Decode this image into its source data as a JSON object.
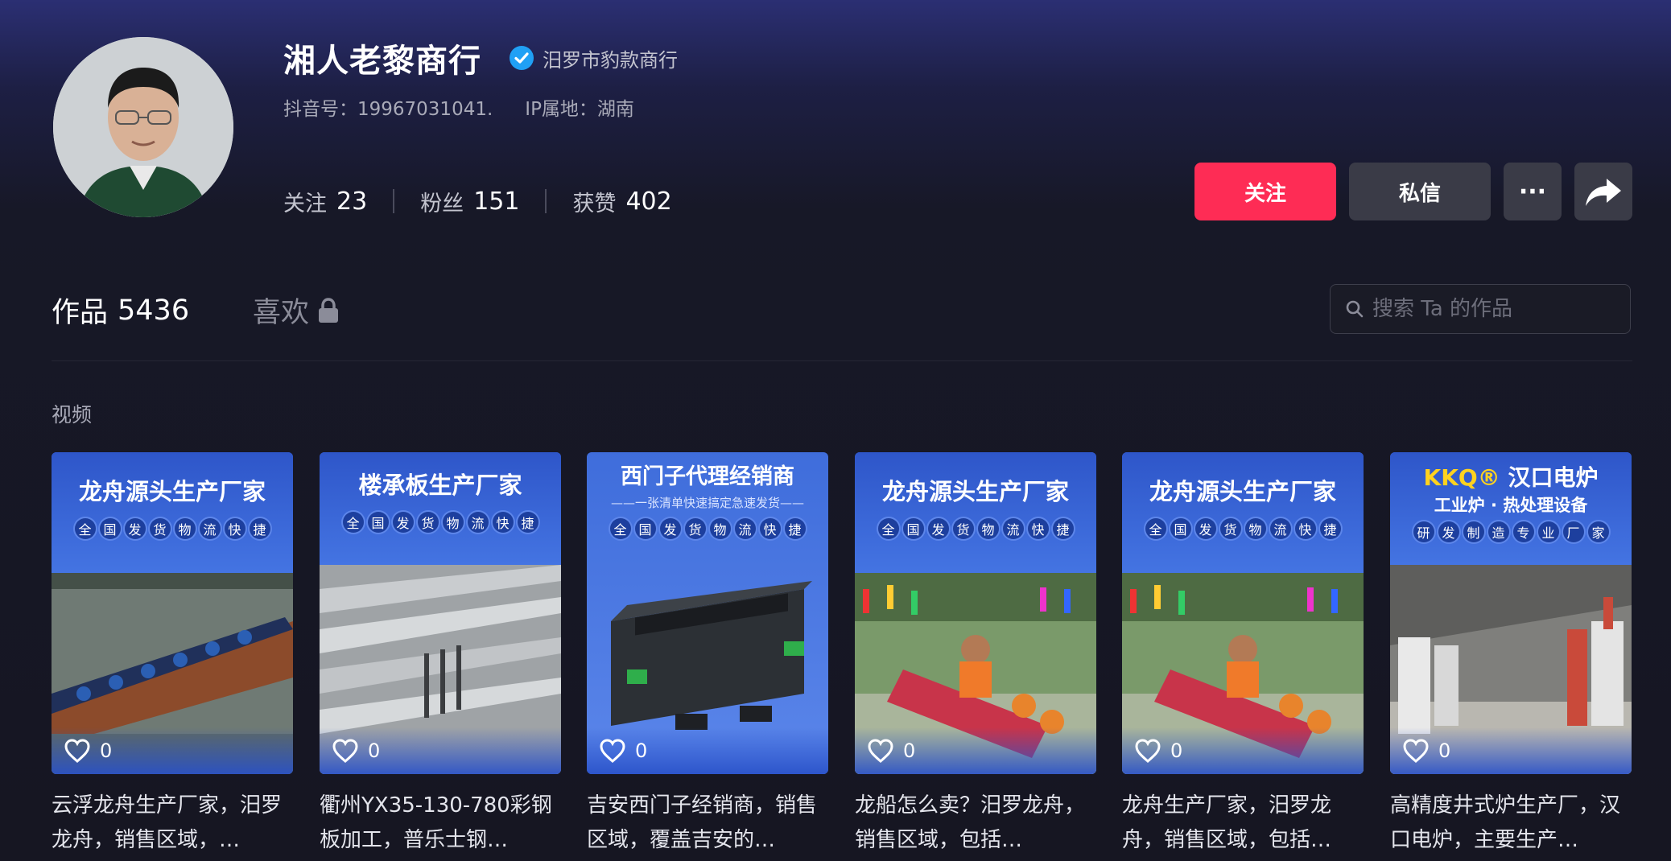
{
  "profile": {
    "name": "湘人老黎商行",
    "verified_label": "汨罗市豹款商行",
    "douyin_id": "抖音号：19967031041.",
    "ip_location": "IP属地：湖南",
    "stats": [
      {
        "label": "关注",
        "value": "23"
      },
      {
        "label": "粉丝",
        "value": "151"
      },
      {
        "label": "获赞",
        "value": "402"
      }
    ]
  },
  "actions": {
    "follow": "关注",
    "message": "私信",
    "more": "···"
  },
  "tabs": {
    "works_label": "作品",
    "works_count": "5436",
    "likes_label": "喜欢"
  },
  "search": {
    "placeholder": "搜索 Ta 的作品"
  },
  "section_label": "视频",
  "videos": [
    {
      "banner": "龙舟源头生产厂家",
      "chips": [
        "全",
        "国",
        "发",
        "货",
        "物",
        "流",
        "快",
        "捷"
      ],
      "likes": "0",
      "title": "云浮龙舟生产厂家，汨罗龙舟，销售区域，…"
    },
    {
      "banner": "楼承板生产厂家",
      "chips": [
        "全",
        "国",
        "发",
        "货",
        "物",
        "流",
        "快",
        "捷"
      ],
      "likes": "0",
      "title": "衢州YX35-130-780彩钢板加工，普乐士钢…"
    },
    {
      "banner": "西门子代理经销商",
      "sub": "——一张清单快速搞定急速发货——",
      "chips": [
        "全",
        "国",
        "发",
        "货",
        "物",
        "流",
        "快",
        "捷"
      ],
      "likes": "0",
      "title": "吉安西门子经销商，销售区域，覆盖吉安的…"
    },
    {
      "banner": "龙舟源头生产厂家",
      "chips": [
        "全",
        "国",
        "发",
        "货",
        "物",
        "流",
        "快",
        "捷"
      ],
      "likes": "0",
      "title": "龙船怎么卖？汨罗龙舟，销售区域，包括…"
    },
    {
      "banner": "龙舟源头生产厂家",
      "chips": [
        "全",
        "国",
        "发",
        "货",
        "物",
        "流",
        "快",
        "捷"
      ],
      "likes": "0",
      "title": "龙舟生产厂家，汨罗龙舟，销售区域，包括…"
    },
    {
      "banner_brand": "KKQ®",
      "banner": "汉口电炉",
      "sub": "工业炉 · 热处理设备",
      "chips": [
        "研",
        "发",
        "制",
        "造",
        "专",
        "业",
        "厂",
        "家"
      ],
      "likes": "0",
      "title": "高精度井式炉生产厂，汉口电炉，主要生产…"
    }
  ],
  "colors": {
    "follow_button": "#fe2c55",
    "secondary_button": "#3a3b47",
    "verified_badge": "#20a0f5",
    "background": "#161622"
  }
}
